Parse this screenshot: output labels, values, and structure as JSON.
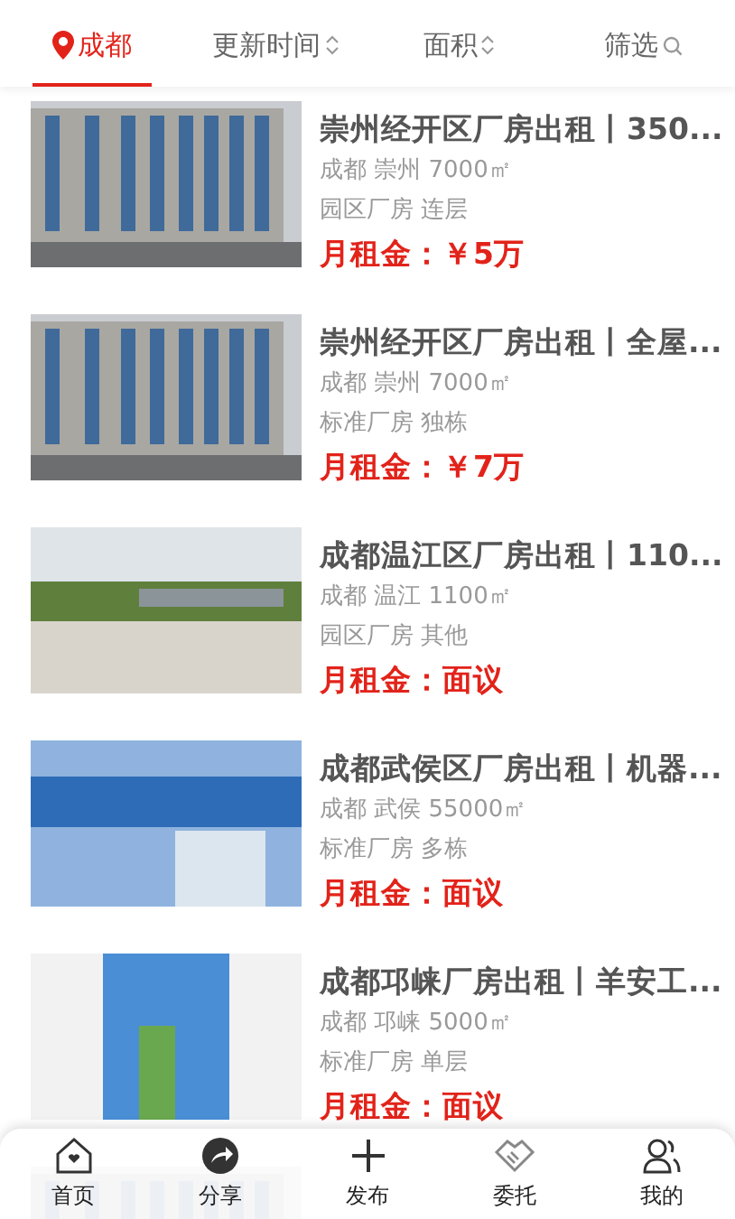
{
  "filters": [
    {
      "label": "成都",
      "kind": "location",
      "selected": true
    },
    {
      "label": "更新时间",
      "kind": "sort",
      "selected": false
    },
    {
      "label": "面积",
      "kind": "sort",
      "selected": false
    },
    {
      "label": "筛选",
      "kind": "search",
      "selected": false
    }
  ],
  "listings": [
    {
      "title": "崇州经开区厂房出租丨350...",
      "location": "成都 崇州 7000㎡",
      "tags": "园区厂房 连层",
      "price": "月租金：￥5万"
    },
    {
      "title": "崇州经开区厂房出租丨全屋...",
      "location": "成都 崇州 7000㎡",
      "tags": "标准厂房 独栋",
      "price": "月租金：￥7万"
    },
    {
      "title": "成都温江区厂房出租丨110...",
      "location": "成都 温江 1100㎡",
      "tags": "园区厂房 其他",
      "price": "月租金：面议"
    },
    {
      "title": "成都武侯区厂房出租丨机器...",
      "location": "成都 武侯 55000㎡",
      "tags": "标准厂房 多栋",
      "price": "月租金：面议"
    },
    {
      "title": "成都邛崃厂房出租丨羊安工...",
      "location": "成都 邛崃 5000㎡",
      "tags": "标准厂房 单层",
      "price": "月租金：面议"
    }
  ],
  "tabbar": [
    {
      "label": "首页"
    },
    {
      "label": "分享"
    },
    {
      "label": "发布"
    },
    {
      "label": "委托"
    },
    {
      "label": "我的"
    }
  ]
}
